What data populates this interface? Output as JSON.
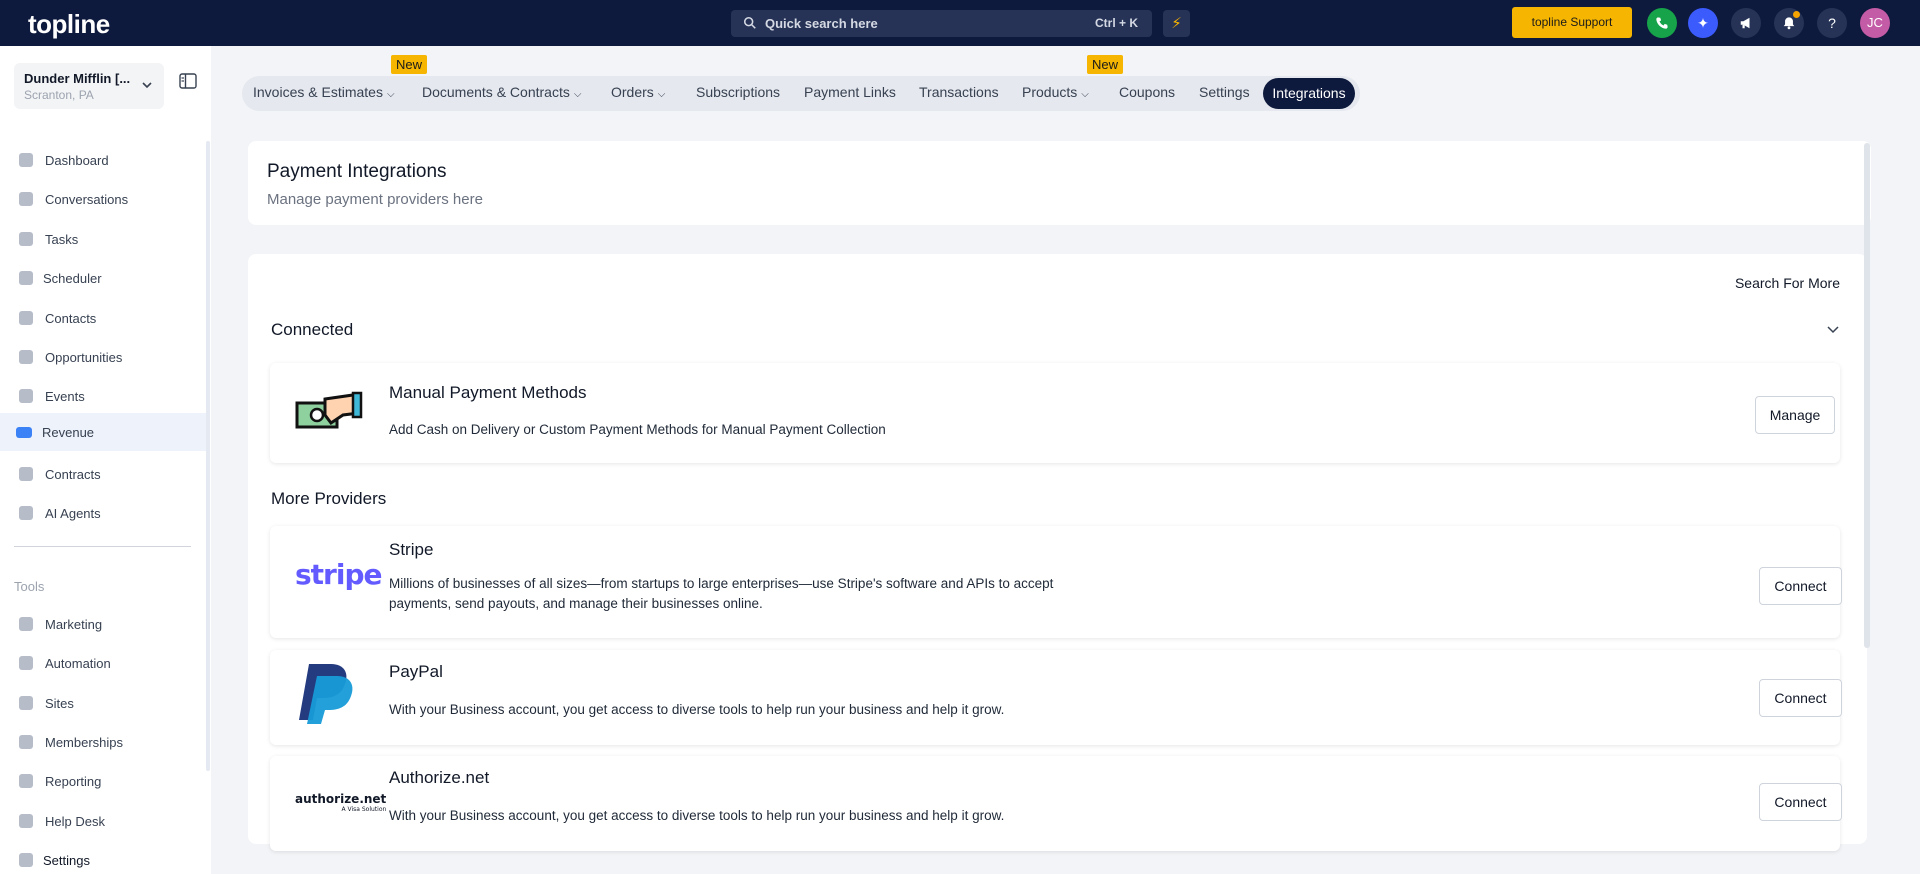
{
  "topbar": {
    "logo": "topline",
    "search_placeholder": "Quick search here",
    "search_shortcut": "Ctrl + K",
    "support_label": "topline Support",
    "avatar_initials": "JC"
  },
  "sidebar": {
    "location_name": "Dunder Mifflin [...",
    "location_city": "Scranton, PA",
    "items": [
      {
        "label": "Dashboard"
      },
      {
        "label": "Conversations"
      },
      {
        "label": "Tasks"
      },
      {
        "label": "Scheduler"
      },
      {
        "label": "Contacts"
      },
      {
        "label": "Opportunities"
      },
      {
        "label": "Events"
      },
      {
        "label": "Revenue"
      },
      {
        "label": "Contracts"
      },
      {
        "label": "AI Agents"
      }
    ],
    "tools_heading": "Tools",
    "tools": [
      {
        "label": "Marketing"
      },
      {
        "label": "Automation"
      },
      {
        "label": "Sites"
      },
      {
        "label": "Memberships"
      },
      {
        "label": "Reporting"
      },
      {
        "label": "Help Desk"
      },
      {
        "label": "Settings"
      }
    ]
  },
  "tabs": {
    "items": [
      {
        "label": "Invoices & Estimates"
      },
      {
        "label": "Documents & Contracts"
      },
      {
        "label": "Orders"
      },
      {
        "label": "Subscriptions"
      },
      {
        "label": "Payment Links"
      },
      {
        "label": "Transactions"
      },
      {
        "label": "Products"
      },
      {
        "label": "Coupons"
      },
      {
        "label": "Settings"
      },
      {
        "label": "Integrations"
      }
    ],
    "new_badge": "New",
    "active": "Integrations"
  },
  "header": {
    "title": "Payment Integrations",
    "subtitle": "Manage payment providers here"
  },
  "main": {
    "search_more": "Search For More",
    "connected_title": "Connected",
    "more_title": "More Providers",
    "connected": [
      {
        "name": "Manual Payment Methods",
        "description": "Add Cash on Delivery or Custom Payment Methods for Manual Payment Collection",
        "button": "Manage"
      }
    ],
    "providers": [
      {
        "name": "Stripe",
        "logo_text": "stripe",
        "description_line1": "Millions of businesses of all sizes—from startups to large enterprises—use Stripe's software and APIs to accept",
        "description_line2": "payments, send payouts, and manage their businesses online.",
        "button": "Connect"
      },
      {
        "name": "PayPal",
        "description": "With your Business account, you get access to diverse tools to help run your business and help it grow.",
        "button": "Connect"
      },
      {
        "name": "Authorize.net",
        "logo_text": "authorize.net",
        "logo_sub": "A Visa Solution",
        "description": "With your Business account, you get access to diverse tools to help run your business and help it grow.",
        "button": "Connect"
      }
    ]
  },
  "colors": {
    "topbar": "#0e1a3d",
    "accent_yellow": "#f5b500",
    "active_tab": "#0e1a3d",
    "stripe": "#635bff"
  }
}
